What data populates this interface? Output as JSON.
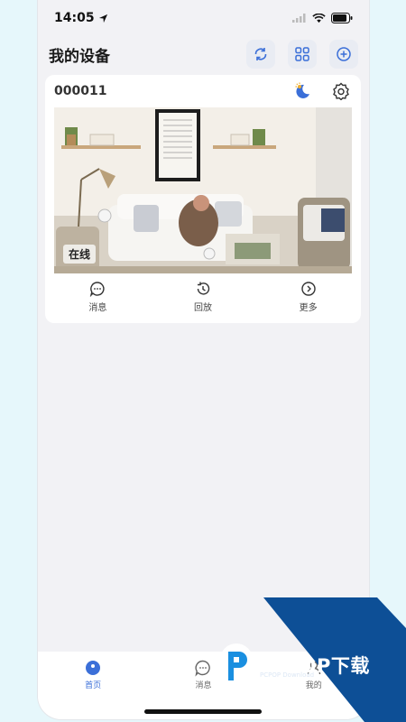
{
  "status_bar": {
    "time": "14:05"
  },
  "header": {
    "title": "我的设备"
  },
  "device": {
    "name": "000011",
    "status": "在线",
    "actions": [
      {
        "label": "消息",
        "icon": "message-icon"
      },
      {
        "label": "回放",
        "icon": "playback-icon"
      },
      {
        "label": "更多",
        "icon": "more-icon"
      }
    ]
  },
  "tabs": [
    {
      "label": "首页",
      "icon": "home-icon",
      "active": true
    },
    {
      "label": "消息",
      "icon": "message-icon",
      "active": false
    },
    {
      "label": "我的",
      "icon": "profile-icon",
      "active": false
    }
  ],
  "colors": {
    "accent": "#3b6fd8",
    "watermark": "#0d4f96"
  },
  "watermark": {
    "text": "PCPOP下载",
    "subtext": "PCPOP Download"
  }
}
